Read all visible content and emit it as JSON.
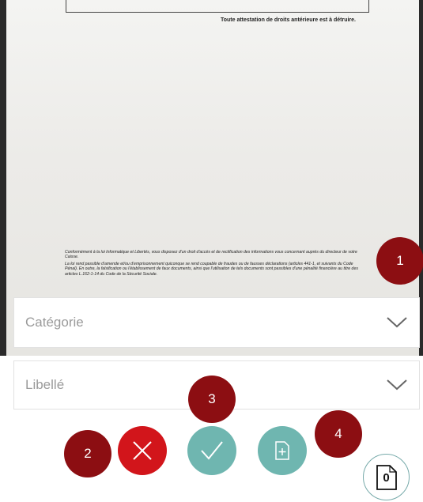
{
  "document": {
    "attestation_text": "Toute attestation de droits antérieure est à détruire.",
    "legal_paragraph_1": "Conformément à la loi Informatique et Libertés, vous disposez d'un droit d'accès et de rectification des informations vous concernant auprès du directeur de votre Caisse.",
    "legal_paragraph_2": "La loi rend passible d'amende et/ou d'emprisonnement quiconque se rend coupable de fraudes ou de fausses déclarations (articles 441-1, et suivants du Code Pénal). En outre, la falsification ou l'établissement de faux documents, ainsi que l'utilisation de tels documents sont passibles d'une pénalité financière au titre des articles L.162-1-14 du Code de la Sécurité Sociale."
  },
  "form": {
    "category": {
      "placeholder": "Catégorie",
      "icon": "chevron-down-icon"
    },
    "label": {
      "placeholder": "Libellé",
      "icon": "chevron-down-icon"
    }
  },
  "actions": {
    "cancel": {
      "icon": "close-icon",
      "color": "#d2151b"
    },
    "confirm": {
      "icon": "checkmark-icon",
      "color": "#6fb6b0"
    },
    "add_page": {
      "icon": "add-document-icon",
      "color": "#6fb6b0"
    }
  },
  "document_counter": {
    "count": "0",
    "icon": "document-icon"
  },
  "markers": [
    "1",
    "2",
    "3",
    "4"
  ],
  "marker_color": "#8c0e12"
}
